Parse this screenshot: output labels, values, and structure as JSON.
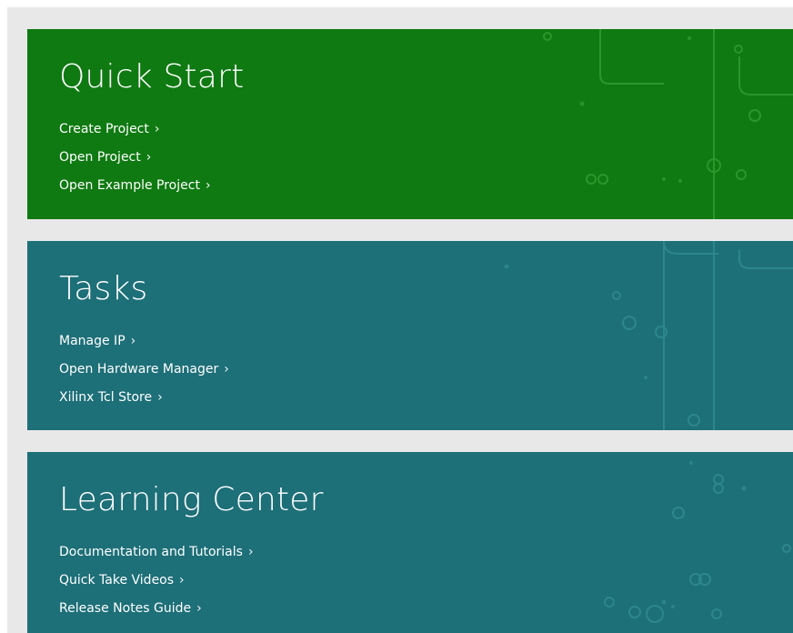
{
  "panels": {
    "quick_start": {
      "title": "Quick Start",
      "links": [
        "Create Project",
        "Open Project",
        "Open Example Project"
      ]
    },
    "tasks": {
      "title": "Tasks",
      "links": [
        "Manage IP",
        "Open Hardware Manager",
        "Xilinx Tcl Store"
      ]
    },
    "learning_center": {
      "title": "Learning Center",
      "links": [
        "Documentation and Tutorials",
        "Quick Take Videos",
        "Release Notes Guide"
      ]
    }
  },
  "chevron": "›",
  "colors": {
    "quick_start_bg": "#0f7a12",
    "panel_bg": "#1d6f78",
    "canvas_bg": "#e8e8e8"
  }
}
